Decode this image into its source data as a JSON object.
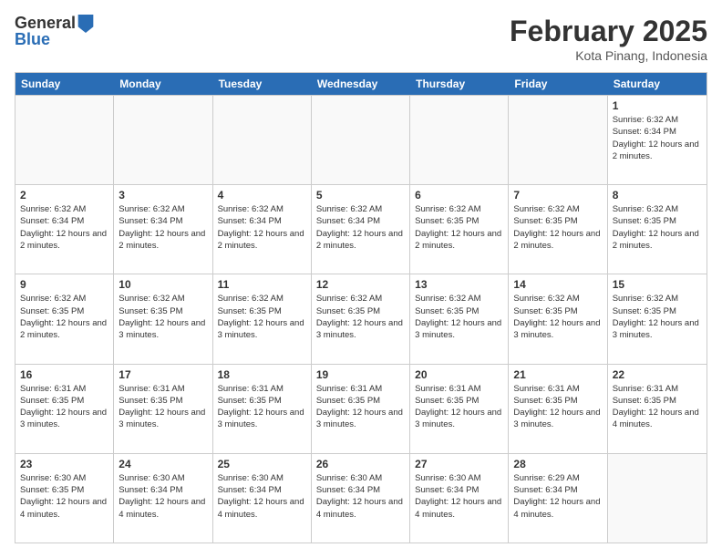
{
  "logo": {
    "general": "General",
    "blue": "Blue"
  },
  "title": "February 2025",
  "location": "Kota Pinang, Indonesia",
  "days_header": [
    "Sunday",
    "Monday",
    "Tuesday",
    "Wednesday",
    "Thursday",
    "Friday",
    "Saturday"
  ],
  "weeks": [
    [
      {
        "day": "",
        "info": ""
      },
      {
        "day": "",
        "info": ""
      },
      {
        "day": "",
        "info": ""
      },
      {
        "day": "",
        "info": ""
      },
      {
        "day": "",
        "info": ""
      },
      {
        "day": "",
        "info": ""
      },
      {
        "day": "1",
        "info": "Sunrise: 6:32 AM\nSunset: 6:34 PM\nDaylight: 12 hours and 2 minutes."
      }
    ],
    [
      {
        "day": "2",
        "info": "Sunrise: 6:32 AM\nSunset: 6:34 PM\nDaylight: 12 hours and 2 minutes."
      },
      {
        "day": "3",
        "info": "Sunrise: 6:32 AM\nSunset: 6:34 PM\nDaylight: 12 hours and 2 minutes."
      },
      {
        "day": "4",
        "info": "Sunrise: 6:32 AM\nSunset: 6:34 PM\nDaylight: 12 hours and 2 minutes."
      },
      {
        "day": "5",
        "info": "Sunrise: 6:32 AM\nSunset: 6:34 PM\nDaylight: 12 hours and 2 minutes."
      },
      {
        "day": "6",
        "info": "Sunrise: 6:32 AM\nSunset: 6:35 PM\nDaylight: 12 hours and 2 minutes."
      },
      {
        "day": "7",
        "info": "Sunrise: 6:32 AM\nSunset: 6:35 PM\nDaylight: 12 hours and 2 minutes."
      },
      {
        "day": "8",
        "info": "Sunrise: 6:32 AM\nSunset: 6:35 PM\nDaylight: 12 hours and 2 minutes."
      }
    ],
    [
      {
        "day": "9",
        "info": "Sunrise: 6:32 AM\nSunset: 6:35 PM\nDaylight: 12 hours and 2 minutes."
      },
      {
        "day": "10",
        "info": "Sunrise: 6:32 AM\nSunset: 6:35 PM\nDaylight: 12 hours and 3 minutes."
      },
      {
        "day": "11",
        "info": "Sunrise: 6:32 AM\nSunset: 6:35 PM\nDaylight: 12 hours and 3 minutes."
      },
      {
        "day": "12",
        "info": "Sunrise: 6:32 AM\nSunset: 6:35 PM\nDaylight: 12 hours and 3 minutes."
      },
      {
        "day": "13",
        "info": "Sunrise: 6:32 AM\nSunset: 6:35 PM\nDaylight: 12 hours and 3 minutes."
      },
      {
        "day": "14",
        "info": "Sunrise: 6:32 AM\nSunset: 6:35 PM\nDaylight: 12 hours and 3 minutes."
      },
      {
        "day": "15",
        "info": "Sunrise: 6:32 AM\nSunset: 6:35 PM\nDaylight: 12 hours and 3 minutes."
      }
    ],
    [
      {
        "day": "16",
        "info": "Sunrise: 6:31 AM\nSunset: 6:35 PM\nDaylight: 12 hours and 3 minutes."
      },
      {
        "day": "17",
        "info": "Sunrise: 6:31 AM\nSunset: 6:35 PM\nDaylight: 12 hours and 3 minutes."
      },
      {
        "day": "18",
        "info": "Sunrise: 6:31 AM\nSunset: 6:35 PM\nDaylight: 12 hours and 3 minutes."
      },
      {
        "day": "19",
        "info": "Sunrise: 6:31 AM\nSunset: 6:35 PM\nDaylight: 12 hours and 3 minutes."
      },
      {
        "day": "20",
        "info": "Sunrise: 6:31 AM\nSunset: 6:35 PM\nDaylight: 12 hours and 3 minutes."
      },
      {
        "day": "21",
        "info": "Sunrise: 6:31 AM\nSunset: 6:35 PM\nDaylight: 12 hours and 3 minutes."
      },
      {
        "day": "22",
        "info": "Sunrise: 6:31 AM\nSunset: 6:35 PM\nDaylight: 12 hours and 4 minutes."
      }
    ],
    [
      {
        "day": "23",
        "info": "Sunrise: 6:30 AM\nSunset: 6:35 PM\nDaylight: 12 hours and 4 minutes."
      },
      {
        "day": "24",
        "info": "Sunrise: 6:30 AM\nSunset: 6:34 PM\nDaylight: 12 hours and 4 minutes."
      },
      {
        "day": "25",
        "info": "Sunrise: 6:30 AM\nSunset: 6:34 PM\nDaylight: 12 hours and 4 minutes."
      },
      {
        "day": "26",
        "info": "Sunrise: 6:30 AM\nSunset: 6:34 PM\nDaylight: 12 hours and 4 minutes."
      },
      {
        "day": "27",
        "info": "Sunrise: 6:30 AM\nSunset: 6:34 PM\nDaylight: 12 hours and 4 minutes."
      },
      {
        "day": "28",
        "info": "Sunrise: 6:29 AM\nSunset: 6:34 PM\nDaylight: 12 hours and 4 minutes."
      },
      {
        "day": "",
        "info": ""
      }
    ]
  ]
}
